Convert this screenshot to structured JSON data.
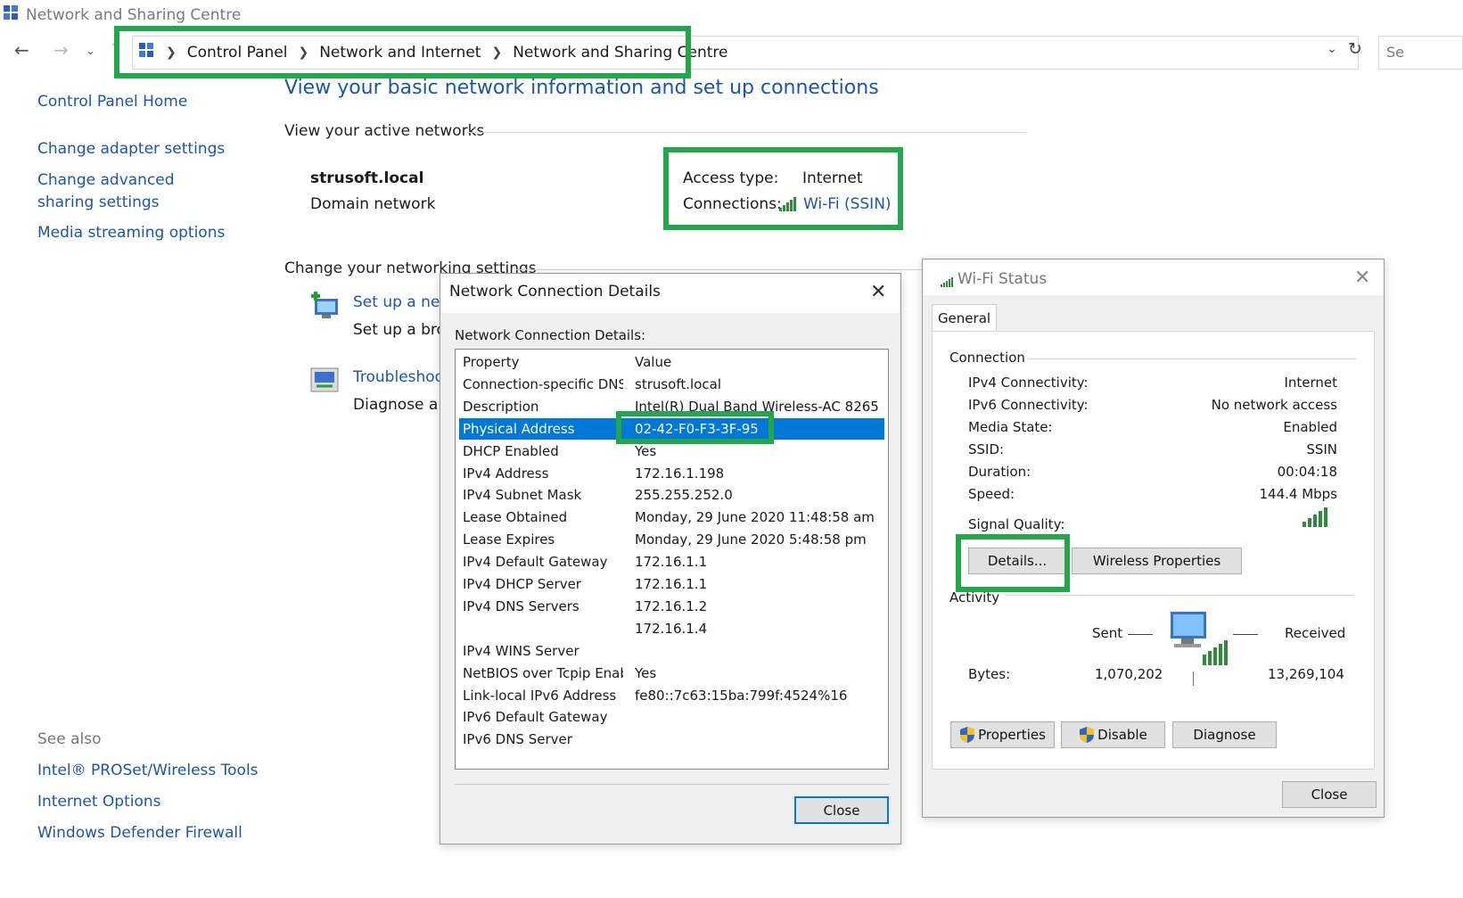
{
  "window": {
    "title": "Network and Sharing Centre"
  },
  "address_bar": {
    "crumbs": [
      "Control Panel",
      "Network and Internet",
      "Network and Sharing Centre"
    ],
    "search_placeholder": "Se"
  },
  "left_nav": {
    "home": "Control Panel Home",
    "items": [
      "Change adapter settings",
      "Change advanced sharing settings",
      "Media streaming options"
    ],
    "see_also_title": "See also",
    "see_also": [
      "Intel® PROSet/Wireless Tools",
      "Internet Options",
      "Windows Defender Firewall"
    ]
  },
  "main": {
    "heading": "View your basic network information and set up connections",
    "active_networks_label": "View your active networks",
    "network_name": "strusoft.local",
    "network_type": "Domain network",
    "access_type_label": "Access type:",
    "access_type_value": "Internet",
    "connections_label": "Connections:",
    "connections_value": "Wi-Fi (SSIN)",
    "change_settings_label": "Change your networking settings",
    "setup_link": "Set up a new",
    "setup_desc": "Set up a broa",
    "troubleshoot_link": "Troubleshoot",
    "troubleshoot_desc": "Diagnose and"
  },
  "details_dialog": {
    "title": "Network Connection Details",
    "list_label": "Network Connection Details:",
    "col_property": "Property",
    "col_value": "Value",
    "rows": [
      {
        "p": "Connection-specific DNS ...",
        "v": "strusoft.local"
      },
      {
        "p": "Description",
        "v": "Intel(R) Dual Band Wireless-AC 8265"
      },
      {
        "p": "Physical Address",
        "v": "02-42-F0-F3-3F-95"
      },
      {
        "p": "DHCP Enabled",
        "v": "Yes"
      },
      {
        "p": "IPv4 Address",
        "v": "172.16.1.198"
      },
      {
        "p": "IPv4 Subnet Mask",
        "v": "255.255.252.0"
      },
      {
        "p": "Lease Obtained",
        "v": "Monday, 29 June 2020 11:48:58 am"
      },
      {
        "p": "Lease Expires",
        "v": "Monday, 29 June 2020 5:48:58 pm"
      },
      {
        "p": "IPv4 Default Gateway",
        "v": "172.16.1.1"
      },
      {
        "p": "IPv4 DHCP Server",
        "v": "172.16.1.1"
      },
      {
        "p": "IPv4 DNS Servers",
        "v": "172.16.1.2"
      },
      {
        "p": "",
        "v": "172.16.1.4"
      },
      {
        "p": "IPv4 WINS Server",
        "v": ""
      },
      {
        "p": "NetBIOS over Tcpip Enab...",
        "v": "Yes"
      },
      {
        "p": "Link-local IPv6 Address",
        "v": "fe80::7c63:15ba:799f:4524%16"
      },
      {
        "p": "IPv6 Default Gateway",
        "v": ""
      },
      {
        "p": "IPv6 DNS Server",
        "v": ""
      }
    ],
    "close_label": "Close"
  },
  "wifi_dialog": {
    "title": "Wi-Fi Status",
    "tab": "General",
    "connection_label": "Connection",
    "fields": [
      {
        "k": "IPv4 Connectivity:",
        "v": "Internet"
      },
      {
        "k": "IPv6 Connectivity:",
        "v": "No network access"
      },
      {
        "k": "Media State:",
        "v": "Enabled"
      },
      {
        "k": "SSID:",
        "v": "SSIN"
      },
      {
        "k": "Duration:",
        "v": "00:04:18"
      },
      {
        "k": "Speed:",
        "v": "144.4 Mbps"
      }
    ],
    "signal_label": "Signal Quality:",
    "details_button": "Details...",
    "wireless_props_button": "Wireless Properties",
    "activity_label": "Activity",
    "sent_label": "Sent",
    "received_label": "Received",
    "bytes_label": "Bytes:",
    "bytes_sent": "1,070,202",
    "bytes_received": "13,269,104",
    "properties_button": "Properties",
    "disable_button": "Disable",
    "diagnose_button": "Diagnose",
    "close_button": "Close"
  },
  "colors": {
    "highlight_green": "#22a84b",
    "link_blue": "#1a56b0",
    "selection_blue": "#0078d7"
  }
}
